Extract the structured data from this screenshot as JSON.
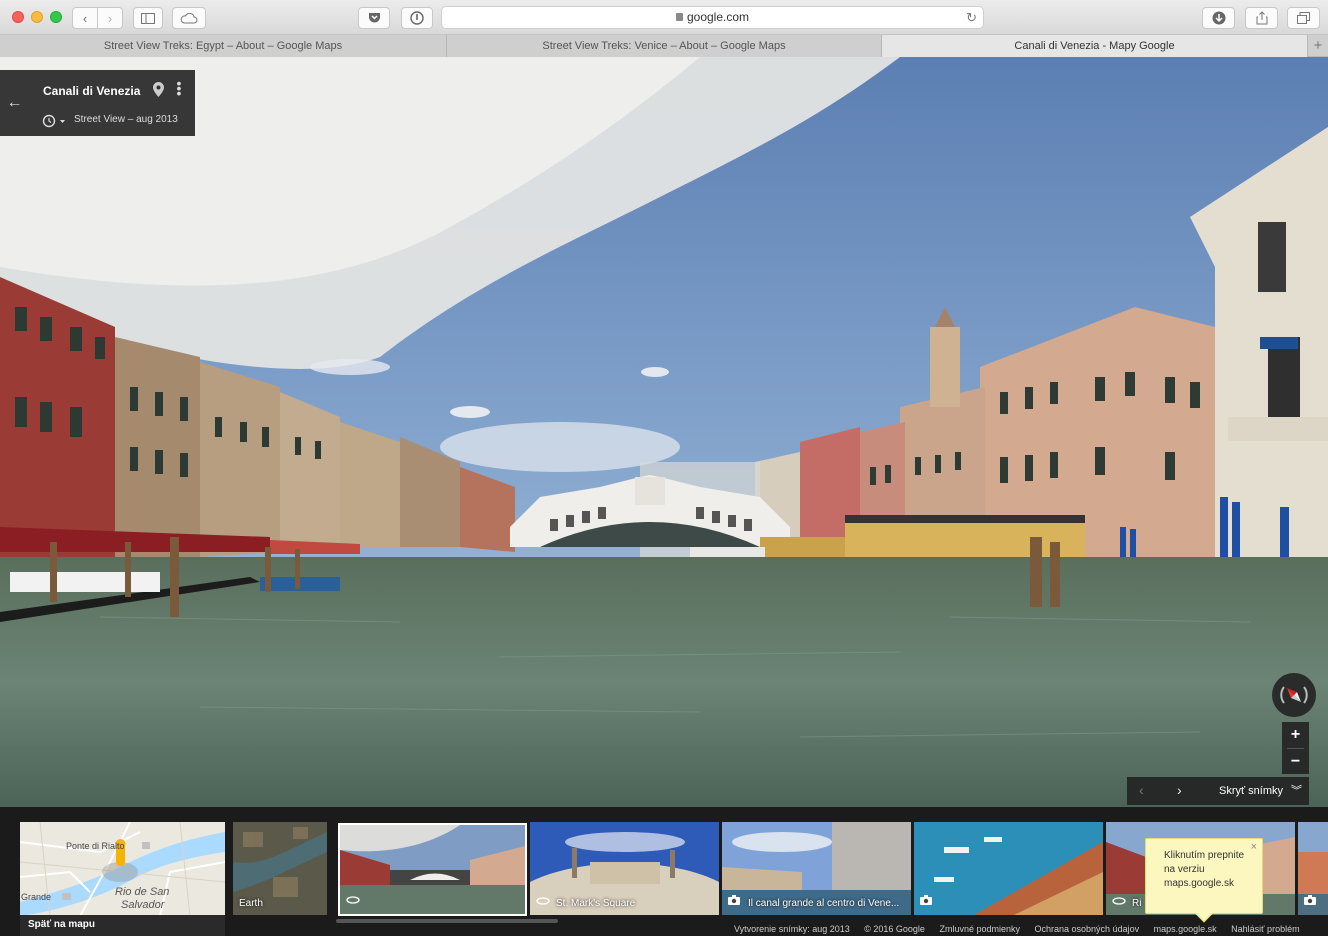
{
  "browser": {
    "url": "google.com",
    "tabs": [
      {
        "label": "Street View Treks: Egypt – About – Google Maps",
        "active": false
      },
      {
        "label": "Street View Treks: Venice – About – Google Maps",
        "active": false
      },
      {
        "label": "Canali di Venezia - Mapy Google",
        "active": true
      }
    ],
    "new_tab": "+"
  },
  "card": {
    "title": "Canali di Venezia",
    "subtitle": "Street View – aug 2013"
  },
  "controls": {
    "zoom_in": "+",
    "zoom_out": "−",
    "hide_photos": "Skryť snímky"
  },
  "filmstrip": {
    "map_labels": {
      "ponte": "Ponte di Rialto",
      "grande": "Grande",
      "rio": "Rio de San",
      "salvador": "Salvador"
    },
    "map_footer": "Späť na mapu",
    "thumbs": [
      {
        "label": "Earth"
      },
      {
        "label": ""
      },
      {
        "label": "St. Mark's Square"
      },
      {
        "label": "Il canal grande al centro di Vene..."
      },
      {
        "label": ""
      },
      {
        "label": "Ri"
      },
      {
        "label": ""
      }
    ],
    "tooltip": "Kliknutím prepnite na verziu maps.google.sk",
    "footer": [
      "Vytvorenie snímky: aug 2013",
      "© 2016 Google",
      "Zmluvné podmienky",
      "Ochrana osobných údajov",
      "maps.google.sk",
      "Nahlásiť problém"
    ]
  },
  "colors": {
    "accent": "#fbf7bf",
    "panel": "#222222"
  }
}
